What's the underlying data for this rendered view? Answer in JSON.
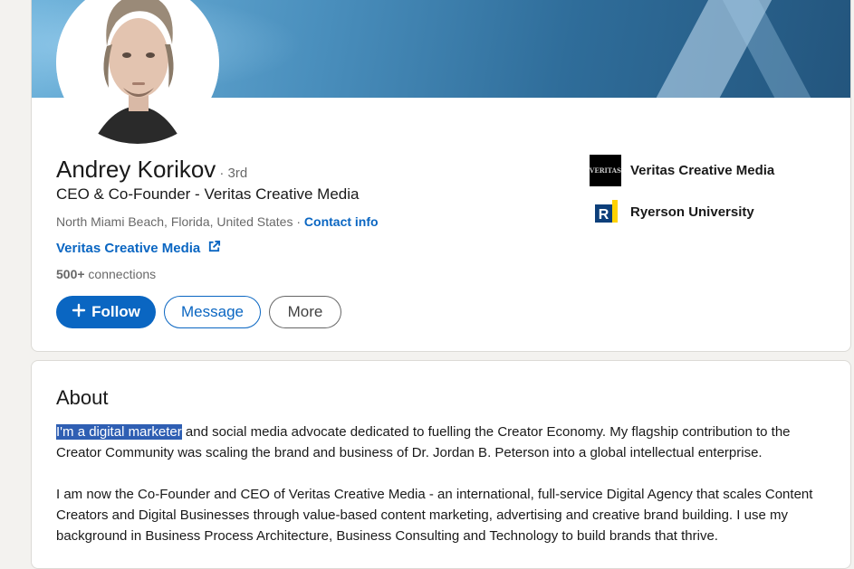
{
  "profile": {
    "name": "Andrey Korikov",
    "degree": "· 3rd",
    "headline": "CEO & Co-Founder - Veritas Creative Media",
    "location": "North Miami Beach, Florida, United States",
    "location_separator": " · ",
    "contact_info_label": "Contact info",
    "website_label": "Veritas Creative Media",
    "connections_count": "500+",
    "connections_label": " connections"
  },
  "actions": {
    "follow_icon": "plus-icon",
    "follow_label": "Follow",
    "message_label": "Message",
    "more_label": "More"
  },
  "organizations": [
    {
      "name": "Veritas Creative Media",
      "logo_text": "VERITAS"
    },
    {
      "name": "Ryerson University",
      "logo_text": "R"
    }
  ],
  "about": {
    "title": "About",
    "highlighted_text": "I'm a digital marketer",
    "paragraph1_rest": " and social media advocate dedicated to fuelling the Creator Economy. My flagship contribution to the Creator Community was scaling the brand and business of Dr. Jordan B. Peterson into a global intellectual enterprise.",
    "paragraph2": "I am now the Co-Founder and CEO of Veritas Creative Media - an international, full-service Digital Agency that scales Content Creators and Digital Businesses through value-based content marketing, advertising and creative brand building. I use my background in Business Process Architecture, Business Consulting and Technology to build brands that thrive."
  },
  "colors": {
    "brand_blue": "#0a66c2",
    "page_background": "#f3f2ef",
    "selection_highlight": "#2f5fb3",
    "ryerson_blue": "#0d3f7a",
    "ryerson_yellow": "#ffd200"
  }
}
